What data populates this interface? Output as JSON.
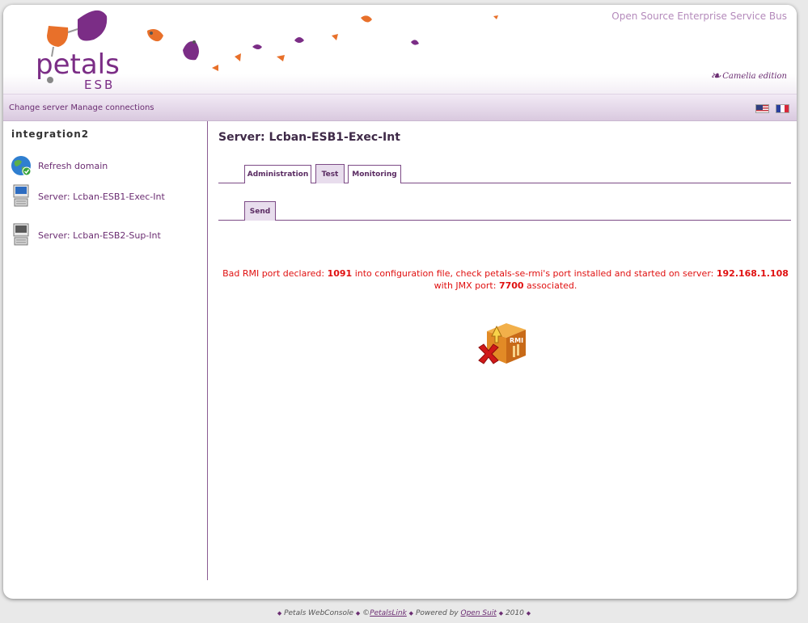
{
  "header": {
    "logo_text": "petals",
    "logo_sub": "ESB",
    "tagline": "Open Source Enterprise Service Bus",
    "edition": "Camelia edition"
  },
  "topbar": {
    "change_server": "Change server",
    "manage_connections": "Manage connections",
    "flags": [
      "us-flag-icon",
      "fr-flag-icon"
    ]
  },
  "sidebar": {
    "domain": "integration2",
    "items": [
      {
        "label": "Refresh domain",
        "icon": "globe-refresh-icon"
      },
      {
        "label": "Server: Lcban-ESB1-Exec-Int",
        "icon": "server-icon"
      },
      {
        "label": "Server: Lcban-ESB2-Sup-Int",
        "icon": "server-icon"
      }
    ]
  },
  "main": {
    "title": "Server: Lcban-ESB1-Exec-Int",
    "tabs": [
      {
        "label": "Administration",
        "active": false
      },
      {
        "label": "Test",
        "active": true
      },
      {
        "label": "Monitoring",
        "active": false
      }
    ],
    "subtabs": [
      {
        "label": "Send",
        "active": true
      }
    ],
    "error": {
      "p1": "Bad RMI port declared: ",
      "port": "1091",
      "p2": " into configuration file, check petals-se-rmi's port installed and started on server: ",
      "server": "192.168.1.108",
      "p3": " with JMX port: ",
      "jmx": "7700",
      "p4": " associated."
    },
    "error_icon": "rmi-package-error-icon",
    "error_icon_label": "RMI"
  },
  "footer": {
    "app": "Petals WebConsole",
    "copyright": "©",
    "company": "PetalsLink",
    "powered": "Powered by",
    "powered_by": "Open Suit",
    "year": "2010"
  },
  "colors": {
    "brand_purple": "#6b2d72",
    "brand_orange": "#e8702a",
    "error_red": "#e01010",
    "topbar_lavender": "#e6dcea"
  }
}
